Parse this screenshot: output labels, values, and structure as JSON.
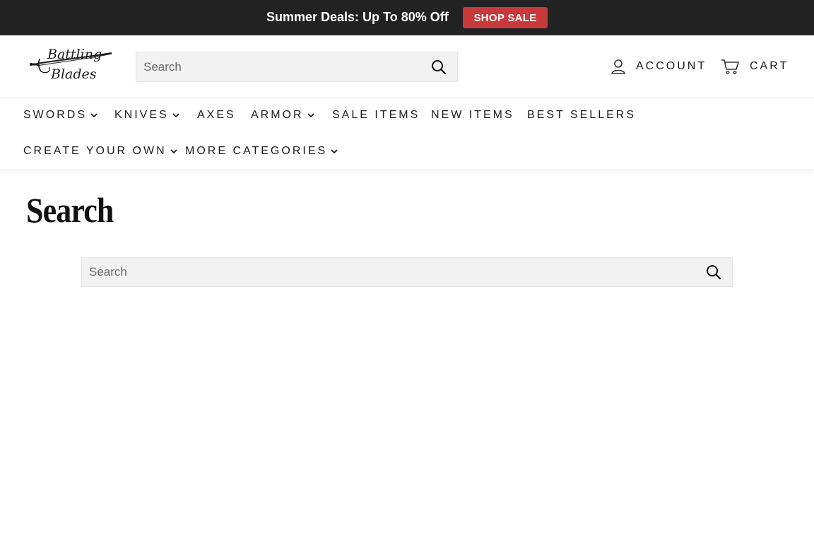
{
  "announcement": {
    "text": "Summer Deals: Up To 80% Off",
    "button_label": "SHOP SALE",
    "background": "#222222",
    "button_color": "#c8393c"
  },
  "header": {
    "logo": {
      "line1": "Battling",
      "line2": "Blades",
      "icon": "sword-icon"
    },
    "search_placeholder": "Search",
    "account_label": "ACCOUNT",
    "cart_label": "CART"
  },
  "nav": {
    "items": [
      {
        "label": "SWORDS",
        "has_dropdown": true
      },
      {
        "label": "KNIVES",
        "has_dropdown": true
      },
      {
        "label": "AXES",
        "has_dropdown": false
      },
      {
        "label": "ARMOR",
        "has_dropdown": true
      },
      {
        "label": "SALE ITEMS",
        "has_dropdown": false
      },
      {
        "label": "NEW ITEMS",
        "has_dropdown": false
      },
      {
        "label": "BEST SELLERS",
        "has_dropdown": false
      },
      {
        "label": "CREATE YOUR OWN",
        "has_dropdown": true
      },
      {
        "label": "MORE CATEGORIES",
        "has_dropdown": true
      }
    ]
  },
  "page": {
    "title": "Search",
    "search_placeholder": "Search"
  }
}
